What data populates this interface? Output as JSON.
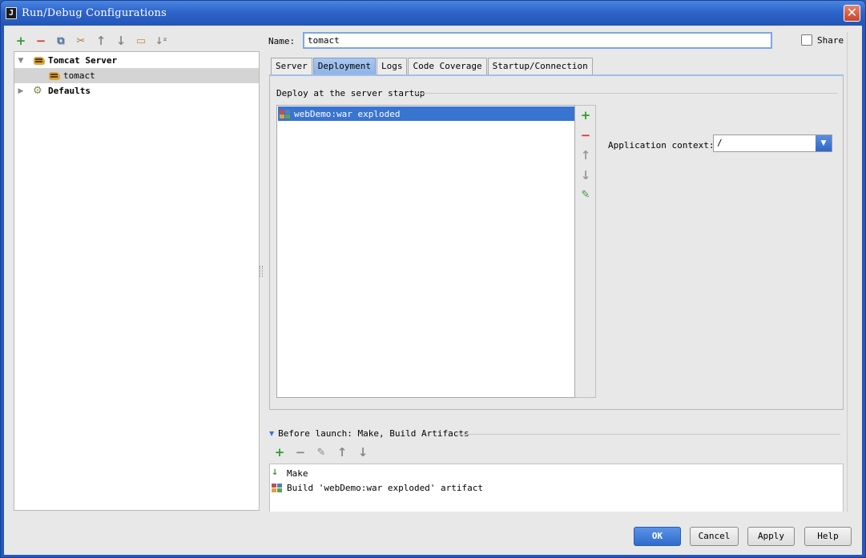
{
  "window": {
    "title": "Run/Debug Configurations",
    "app_icon_glyph": "J",
    "close_glyph": "✕"
  },
  "left_toolbar": {
    "icons": [
      "add-icon",
      "remove-icon",
      "copy-icon",
      "edit-defaults-icon",
      "move-up-icon",
      "move-down-icon",
      "folder-icon",
      "sort-icon"
    ],
    "glyphs": [
      "+",
      "−",
      "⧉",
      "✂",
      "↑",
      "↓",
      "▭",
      "↓ᶻ"
    ]
  },
  "tree": {
    "items": [
      {
        "label": "Tomcat Server",
        "expanded": true,
        "glyph": "▼"
      },
      {
        "label": "tomact",
        "selected": true
      },
      {
        "label": "Defaults",
        "expanded": false,
        "glyph": "▶"
      }
    ]
  },
  "config": {
    "name_label": "Name:",
    "name_value": "tomact",
    "share_label": "Share",
    "share_checked": false
  },
  "tabs": [
    {
      "label": "Server"
    },
    {
      "label": "Deployment",
      "active": true
    },
    {
      "label": "Logs"
    },
    {
      "label": "Code Coverage"
    },
    {
      "label": "Startup/Connection"
    }
  ],
  "deployment": {
    "section_title": "Deploy at the server startup",
    "items": [
      "webDemo:war exploded"
    ],
    "side_glyphs": [
      "+",
      "−",
      "↑",
      "↓",
      "✎"
    ],
    "app_context_label": "Application context:",
    "app_context_value": "/",
    "dropdown_glyph": "▼"
  },
  "before_launch": {
    "header": "Before launch: Make, Build Artifacts",
    "header_glyph": "▼",
    "toolbar_glyphs": [
      "+",
      "−",
      "✎",
      "↑",
      "↓"
    ],
    "items": [
      "Make",
      "Build 'webDemo:war exploded' artifact"
    ],
    "make_glyph": "↓"
  },
  "buttons": {
    "ok": "OK",
    "cancel": "Cancel",
    "apply": "Apply",
    "help": "Help"
  },
  "colors": {
    "accent": "#3874d0",
    "add_green": "#2e9c2e",
    "remove_red": "#d43a2a"
  }
}
